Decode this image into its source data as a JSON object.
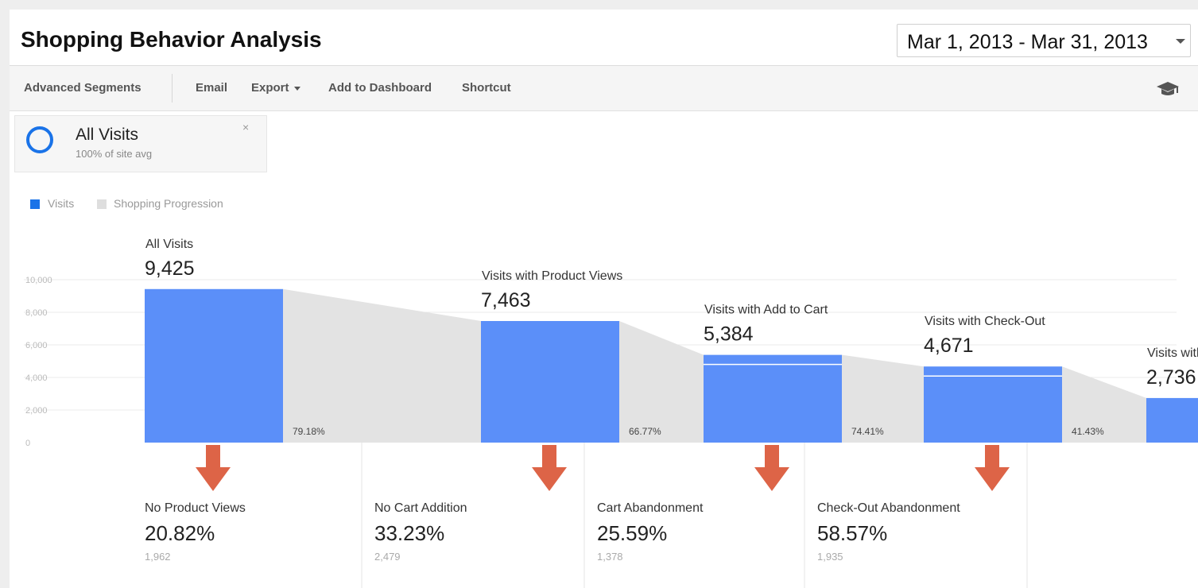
{
  "header": {
    "title": "Shopping Behavior Analysis",
    "date_range": "Mar 1, 2013 - Mar 31, 2013"
  },
  "toolbar": {
    "advanced_segments": "Advanced Segments",
    "email": "Email",
    "export": "Export",
    "add_to_dashboard": "Add to Dashboard",
    "shortcut": "Shortcut"
  },
  "segment": {
    "name": "All Visits",
    "subtitle": "100% of site avg",
    "close_glyph": "×"
  },
  "legend": {
    "visits": "Visits",
    "shopping_progression": "Shopping Progression",
    "visits_color": "#1a73e8",
    "progression_color": "#dedede"
  },
  "colors": {
    "bar": "#5b8ff9",
    "progression": "#e3e3e3",
    "arrow": "#dd6447",
    "grid": "#ebebeb"
  },
  "chart_data": {
    "type": "bar",
    "ylim": [
      0,
      10000
    ],
    "yticks": [
      "0",
      "2,000",
      "4,000",
      "6,000",
      "8,000",
      "10,000"
    ],
    "stages": [
      {
        "label": "All Visits",
        "value": 9425,
        "value_text": "9,425",
        "conversion": "79.18%",
        "dropoff": {
          "label": "No Product Views",
          "percent": "20.82%",
          "count": "1,962"
        }
      },
      {
        "label": "Visits with Product Views",
        "value": 7463,
        "value_text": "7,463",
        "conversion": "66.77%",
        "dropoff": {
          "label": "No Cart Addition",
          "percent": "33.23%",
          "count": "2,479"
        }
      },
      {
        "label": "Visits with Add to Cart",
        "value": 5384,
        "value_text": "5,384",
        "conversion": "74.41%",
        "dropoff": {
          "label": "Cart Abandonment",
          "percent": "25.59%",
          "count": "1,378"
        }
      },
      {
        "label": "Visits with Check-Out",
        "value": 4671,
        "value_text": "4,671",
        "conversion": "41.43%",
        "dropoff": {
          "label": "Check-Out Abandonment",
          "percent": "58.57%",
          "count": "1,935"
        }
      },
      {
        "label": "Visits with Transactions",
        "value": 2736,
        "value_text": "2,736",
        "conversion": "",
        "dropoff": null
      }
    ]
  }
}
